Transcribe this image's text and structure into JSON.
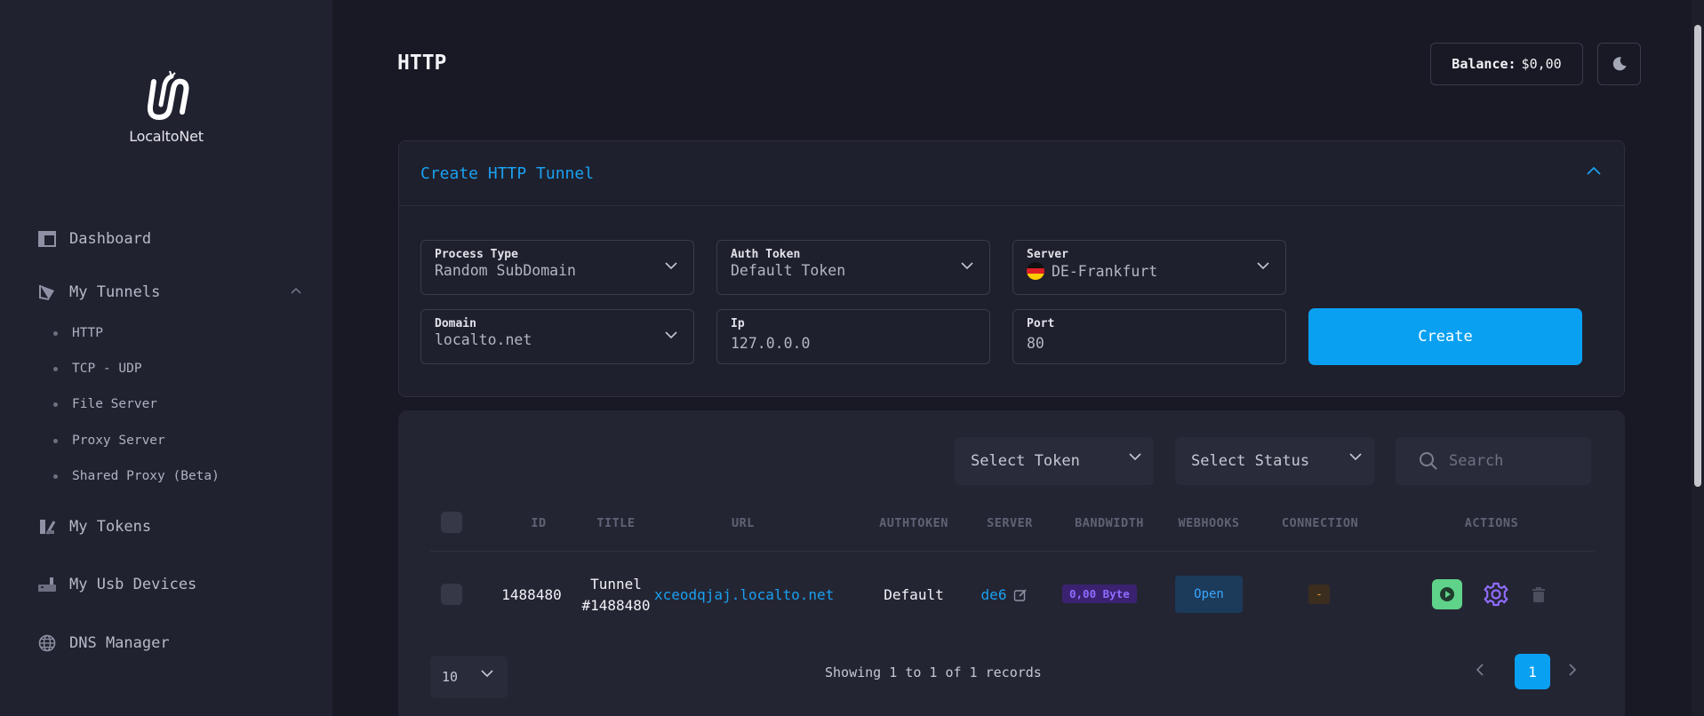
{
  "app": {
    "name": "LocaltoNet"
  },
  "sidebar": {
    "items": [
      {
        "label": "Dashboard",
        "icon": "dashboard-icon"
      },
      {
        "label": "My Tunnels",
        "icon": "tunnels-icon"
      },
      {
        "label": "My Tokens",
        "icon": "tokens-icon"
      },
      {
        "label": "My Usb Devices",
        "icon": "usb-icon"
      },
      {
        "label": "DNS Manager",
        "icon": "globe-icon"
      }
    ],
    "tunnels_sub": [
      "HTTP",
      "TCP - UDP",
      "File Server",
      "Proxy Server",
      "Shared Proxy (Beta)"
    ]
  },
  "header": {
    "title": "HTTP",
    "balance_label": "Balance:",
    "balance_value": "$0,00"
  },
  "create_panel": {
    "title": "Create HTTP Tunnel",
    "process_type": {
      "label": "Process Type",
      "value": "Random SubDomain"
    },
    "auth_token": {
      "label": "Auth Token",
      "value": "Default Token"
    },
    "server": {
      "label": "Server",
      "value": "DE-Frankfurt"
    },
    "domain": {
      "label": "Domain",
      "value": "localto.net"
    },
    "ip": {
      "label": "Ip",
      "value": "127.0.0.0"
    },
    "port": {
      "label": "Port",
      "value": "80"
    },
    "create_label": "Create"
  },
  "filters": {
    "token": "Select Token",
    "status": "Select Status",
    "search_placeholder": "Search"
  },
  "table": {
    "columns": [
      "ID",
      "TITLE",
      "URL",
      "AUTHTOKEN",
      "SERVER",
      "BANDWIDTH",
      "WEBHOOKS",
      "CONNECTION",
      "ACTIONS"
    ],
    "rows": [
      {
        "id": "1488480",
        "title_line1": "Tunnel",
        "title_line2": "#1488480",
        "url": "xceodqjaj.localto.net",
        "authtoken": "Default",
        "server": "de6",
        "bandwidth": "0,00 Byte",
        "webhooks": "Open",
        "connection": "-"
      }
    ]
  },
  "pagination": {
    "per_page": "10",
    "records_text": "Showing 1 to 1 of 1 records",
    "current_page": "1"
  },
  "colors": {
    "accent": "#0aa0f2",
    "play": "#5fd389",
    "purple": "#8f6cff"
  }
}
